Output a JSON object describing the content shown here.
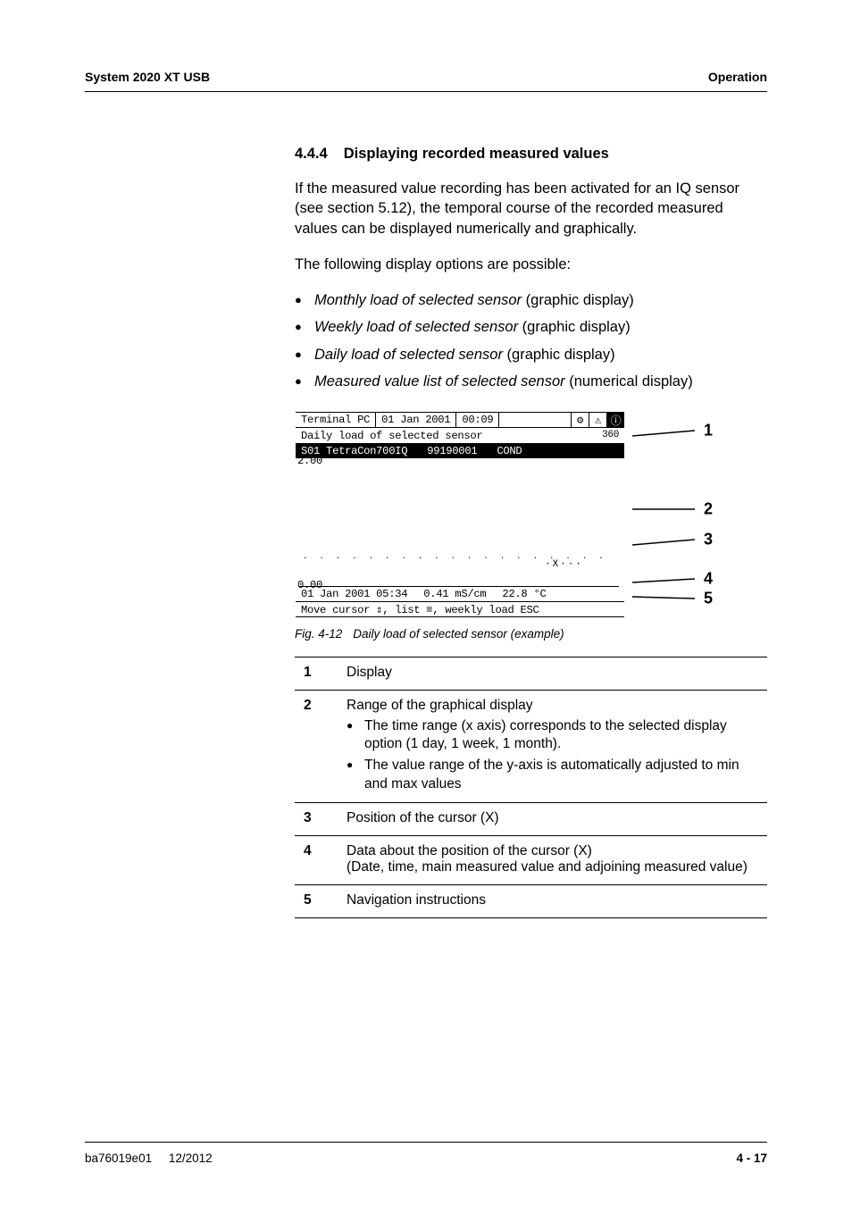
{
  "header": {
    "left": "System 2020 XT USB",
    "right": "Operation"
  },
  "section": {
    "num": "4.4.4",
    "title": "Displaying recorded measured values"
  },
  "intro1": "If the measured value recording has been activated for an IQ sensor (see section 5.12), the temporal course of the recorded measured values can be displayed numerically and graphically.",
  "intro2": "The following display options are possible:",
  "options": [
    {
      "name": "Monthly load of selected sensor",
      "tail": " (graphic display)"
    },
    {
      "name": "Weekly load of selected sensor",
      "tail": " (graphic display)"
    },
    {
      "name": "Daily load of selected sensor",
      "tail": " (graphic display)"
    },
    {
      "name": "Measured value list of selected sensor",
      "tail": " (numerical display)"
    }
  ],
  "screen": {
    "terminal": "Terminal PC",
    "date": "01 Jan  2001",
    "time": "00:09",
    "icon1": "settings-icon",
    "icon2": "warning-icon",
    "icon3": "info-icon",
    "subtitle": "Daily load of selected sensor",
    "deg": "360",
    "sensor_id": "S01 TetraCon700IQ",
    "sensor_no": "99190001",
    "sensor_type": "COND",
    "ymax": "2.00",
    "ymin": "0.00",
    "cursor_marker": "·X···",
    "info_date": "01 Jan  2001 05:34",
    "info_value": "0.41 mS/cm",
    "info_temp": "22.8 °C",
    "help": "Move cursor ⇕, list ≡, weekly load ESC"
  },
  "callout_labels": [
    "1",
    "2",
    "3",
    "4",
    "5"
  ],
  "caption": {
    "num": "Fig. 4-12",
    "text": "Daily load of selected sensor (example)"
  },
  "legend": [
    {
      "n": "1",
      "lines": [
        "Display"
      ]
    },
    {
      "n": "2",
      "head": "Range of the graphical display",
      "bullets": [
        "The time range (x axis) corresponds to the selected display option (1 day, 1 week, 1 month).",
        "The value range of the y-axis is automatically adjusted to min and max values"
      ]
    },
    {
      "n": "3",
      "lines": [
        "Position of the cursor (X)"
      ]
    },
    {
      "n": "4",
      "lines": [
        "Data about the position of the cursor (X)",
        "(Date, time, main measured value and adjoining measured value)"
      ]
    },
    {
      "n": "5",
      "lines": [
        "Navigation instructions"
      ]
    }
  ],
  "footer": {
    "doc": "ba76019e01",
    "date": "12/2012",
    "page": "4 - 17"
  }
}
